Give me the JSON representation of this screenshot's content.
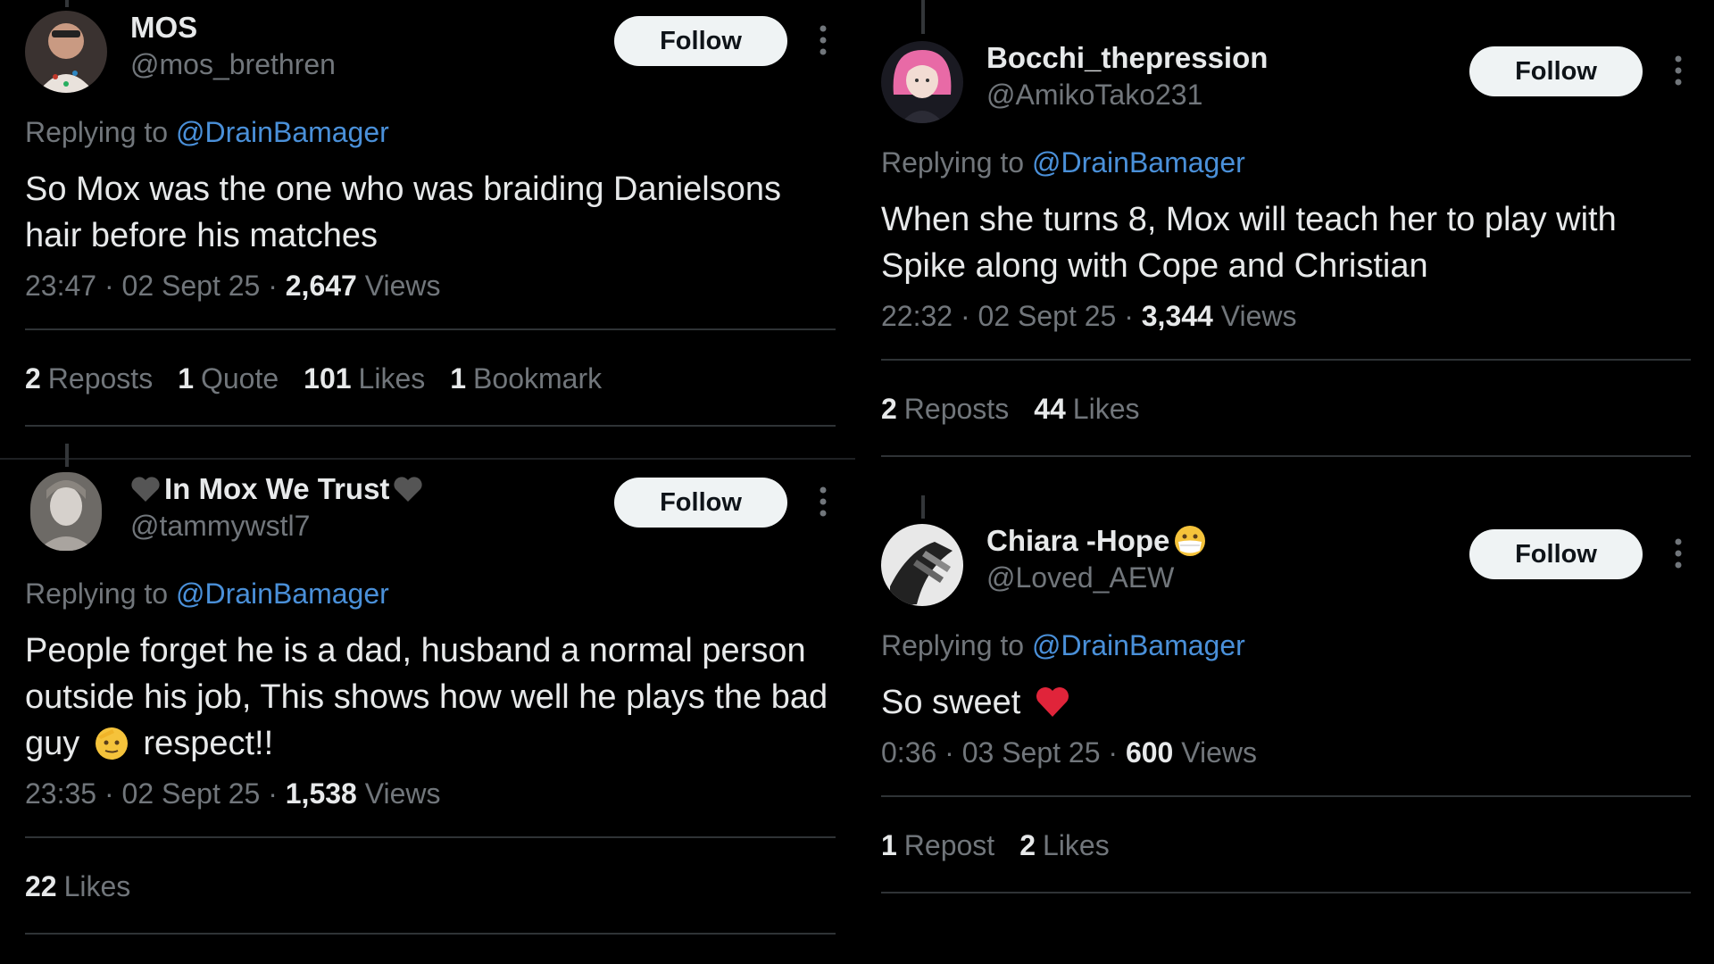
{
  "tweets": [
    {
      "display_name": "MOS",
      "handle": "@mos_brethren",
      "follow_label": "Follow",
      "replying_prefix": "Replying to",
      "replying_handle": "@DrainBamager",
      "text": "So Mox was the one who was braiding Danielsons hair before his matches",
      "time": "23:47",
      "date": "02 Sept 25",
      "views_count": "2,647",
      "views_label": "Views",
      "stats": [
        {
          "count": "2",
          "label": "Reposts"
        },
        {
          "count": "1",
          "label": "Quote"
        },
        {
          "count": "101",
          "label": "Likes"
        },
        {
          "count": "1",
          "label": "Bookmark"
        }
      ]
    },
    {
      "display_name": "In Mox We Trust",
      "handle": "@tammywstl7",
      "follow_label": "Follow",
      "replying_prefix": "Replying to",
      "replying_handle": "@DrainBamager",
      "text": "People forget he is a dad, husband  a normal person outside his job, This shows how well he plays the bad guy",
      "text_after_emoji": "respect!!",
      "time": "23:35",
      "date": "02 Sept 25",
      "views_count": "1,538",
      "views_label": "Views",
      "stats": [
        {
          "count": "22",
          "label": "Likes"
        }
      ]
    },
    {
      "display_name": "Bocchi_thepression",
      "handle": "@AmikoTako231",
      "follow_label": "Follow",
      "replying_prefix": "Replying to",
      "replying_handle": "@DrainBamager",
      "text": "When she turns 8, Mox will teach her to play with Spike along with Cope and Christian",
      "time": "22:32",
      "date": "02 Sept 25",
      "views_count": "3,344",
      "views_label": "Views",
      "stats": [
        {
          "count": "2",
          "label": "Reposts"
        },
        {
          "count": "44",
          "label": "Likes"
        }
      ]
    },
    {
      "display_name": "Chiara -Hope",
      "handle": "@Loved_AEW",
      "follow_label": "Follow",
      "replying_prefix": "Replying to",
      "replying_handle": "@DrainBamager",
      "text": "So sweet",
      "time": "0:36",
      "date": "03 Sept 25",
      "views_count": "600",
      "views_label": "Views",
      "stats": [
        {
          "count": "1",
          "label": "Repost"
        },
        {
          "count": "2",
          "label": "Likes"
        }
      ]
    }
  ],
  "colors": {
    "background": "#000000",
    "text": "#e7e9ea",
    "muted": "#71767b",
    "link": "#4a90d9",
    "divider": "#2f3336",
    "button_bg": "#eff3f4"
  },
  "icons": {
    "more": "vertical-ellipsis-icon",
    "heart": "black-heart-icon",
    "salute": "saluting-face-emoji",
    "mask": "face-with-medical-mask-emoji",
    "red_heart": "red-heart-emoji"
  }
}
